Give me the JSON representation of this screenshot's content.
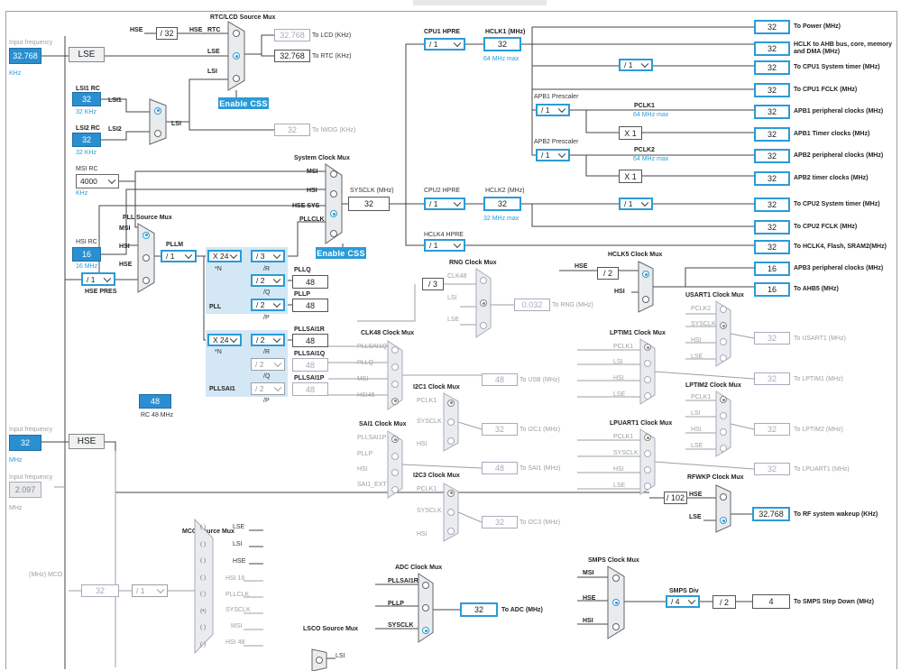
{
  "sections": {
    "rtc_mux": "RTC/LCD Source Mux",
    "system_mux": "System Clock Mux",
    "pll_mux": "PLL Source Mux",
    "hclk5_mux": "HCLK5 Clock Mux",
    "rng_mux": "RNG Clock Mux",
    "usart_mux": "USART1 Clock Mux",
    "clk48_mux": "CLK48 Clock Mux",
    "lptim1_mux": "LPTIM1 Clock Mux",
    "i2c1_mux": "I2C1 Clock Mux",
    "lptim2_mux": "LPTIM2 Clock Mux",
    "sai1_mux": "SAI1 Clock Mux",
    "lpuart_mux": "LPUART1 Clock Mux",
    "i2c3_mux": "I2C3 Clock Mux",
    "rfwkp_mux": "RFWKP Clock Mux",
    "mco_mux": "MCO Source Mux",
    "smps_mux": "SMPS Clock Mux",
    "adc_mux": "ADC Clock Mux",
    "lsco_mux": "LSCO Source Mux"
  },
  "inputs": {
    "lse_freq_label": "Input frequency",
    "lse_freq": "32.768",
    "lse_unit": "KHz",
    "lse_label": "LSE",
    "hse_freq_label": "Input frequency",
    "hse_freq": "32",
    "hse_unit": "MHz",
    "hse_label": "HSE",
    "third_freq_label": "Input frequency",
    "third_freq": "2.097",
    "third_unit": "MHz",
    "mco_label": "(MHz) MCO"
  },
  "rc": {
    "lsi1_label": "LSI1 RC",
    "lsi1_val": "32",
    "lsi1_unit": "32 KHz",
    "lsi2_label": "LSI2 RC",
    "lsi2_val": "32",
    "lsi2_unit": "32 KHz",
    "msi_label": "MSI RC",
    "msi_val": "4000",
    "msi_unit": "KHz",
    "hsi_label": "HSI RC",
    "hsi_val": "16",
    "hsi_unit": "16 MHz",
    "rc48_val": "48",
    "rc48_unit": "RC 48 MHz"
  },
  "labels": {
    "hse": "HSE",
    "rtc": "RTC",
    "div32": "/ 32",
    "lse": "LSE",
    "lsi": "LSI",
    "lsi1": "LSI1",
    "lsi2": "LSI2",
    "to_lcd": "To LCD (KHz)",
    "lcd_val": "32.768",
    "to_rtc": "To RTC (KHz)",
    "rtc_val": "32.768",
    "to_iwdg": "To IWDG (KHz)",
    "iwdg_val": "32",
    "enable_css": "Enable CSS",
    "msi": "MSI",
    "hsi": "HSI",
    "hse_sys": "HSE SYS",
    "pllclk": "PLLCLK",
    "sysclk_label": "SYSCLK (MHz)",
    "sysclk_val": "32",
    "hse_pres": "HSE PRES",
    "hse_pres_val": "/ 1",
    "pllm_label": "PLLM",
    "pllm_val": "/ 1",
    "pll": "PLL",
    "pllsai1": "PLLSAI1",
    "n_star": "*N",
    "r": "/R",
    "q": "/Q",
    "p": "/P",
    "x24": "X 24",
    "div3": "/ 3",
    "div2": "/ 2",
    "pllq": "PLLQ",
    "pllq_val": "48",
    "pllp": "PLLP",
    "pllp_val": "48",
    "pllsai1r": "PLLSAI1R",
    "pllsai1r_val": "48",
    "pllsai1q": "PLLSAI1Q",
    "pllsai1q_val": "48",
    "pllsai1p": "PLLSAI1P",
    "pllsai1p_val": "48",
    "cpu1_hpre": "CPU1 HPRE",
    "cpu1_val": "/ 1",
    "hclk1_label": "HCLK1 (MHz)",
    "hclk1_val": "32",
    "hclk1_max": "64 MHz max",
    "apb1_pres": "APB1 Prescaler",
    "apb1_val": "/ 1",
    "pclk1": "PCLK1",
    "pclk1_max": "64 MHz max",
    "apb2_pres": "APB2 Prescaler",
    "apb2_val": "/ 1",
    "pclk2": "PCLK2",
    "pclk2_max": "64 MHz max",
    "x1": "X 1",
    "cpu2_hpre": "CPU2 HPRE",
    "cpu2_val": "/ 1",
    "hclk2_label": "HCLK2 (MHz)",
    "hclk2_val": "32",
    "hclk2_max": "32 MHz max",
    "hclk4_hpre": "HCLK4 HPRE",
    "hclk4_val": "/ 1",
    "timer_div": "/ 1",
    "div2s": "/ 2",
    "rng_val": "0.032",
    "to_rng": "To RNG (MHz)",
    "to_usb": "To USB (MHz)",
    "usb_val": "48",
    "to_i2c1": "To I2C1 (MHz)",
    "i2c1_val": "32",
    "to_sai1": "To SAI1 (MHz)",
    "sai1_val": "48",
    "to_i2c3": "To I2C3 (MHz)",
    "i2c3_val": "32",
    "to_usart1": "To USART1 (MHz)",
    "usart1_val": "32",
    "to_lptim1": "To LPTIM1 (MHz)",
    "lptim1_val": "32",
    "to_lptim2": "To LPTIM2 (MHz)",
    "lptim2_val": "32",
    "to_lpuart1": "To LPUART1 (MHz)",
    "lpuart1_val": "32",
    "div102": "/ 102",
    "rf_val": "32.768",
    "to_rf": "To RF system wakeup (KHz)",
    "to_adc": "To ADC (MHz)",
    "adc_val": "32",
    "smps_div": "SMPS Div",
    "smps_div_val": "/ 4",
    "smps_val": "4",
    "to_smps": "To SMPS Step Down (MHz)",
    "mco_val": "32",
    "mco_div": "/ 1",
    "clk48": "CLK48",
    "div3b": "/ 3",
    "pclk1s": "PCLK1",
    "pclk2s": "PCLK2",
    "sysclk": "SYSCLK",
    "hsi48": "HSI48",
    "sai1_ext": "SAI1_EXT",
    "pllsai1r_s": "PLLSAI1R",
    "pllp_s": "PLLP",
    "pllq_s": "PLLQ",
    "hsi16": "HSI 16",
    "hsi48s": "HSI 48"
  },
  "outputs": [
    {
      "val": "32",
      "label": "To Power (MHz)"
    },
    {
      "val": "32",
      "label": "HCLK to AHB bus, core, memory and DMA (MHz)"
    },
    {
      "val": "32",
      "label": "To CPU1 System timer (MHz)"
    },
    {
      "val": "32",
      "label": "To CPU1 FCLK (MHz)"
    },
    {
      "val": "32",
      "label": "APB1 peripheral clocks (MHz)"
    },
    {
      "val": "32",
      "label": "APB1 Timer clocks (MHz)"
    },
    {
      "val": "32",
      "label": "APB2 peripheral clocks (MHz)"
    },
    {
      "val": "32",
      "label": "APB2 timer clocks (MHz)"
    },
    {
      "val": "32",
      "label": "To CPU2 System timer (MHz)"
    },
    {
      "val": "32",
      "label": "To CPU2 FCLK (MHz)"
    },
    {
      "val": "32",
      "label": "To HCLK4, Flash, SRAM2(MHz)"
    },
    {
      "val": "16",
      "label": "APB3 peripheral clocks (MHz)"
    },
    {
      "val": "16",
      "label": "To AHB5 (MHz)"
    }
  ],
  "colors": {
    "accent": "#2a9bd7",
    "fill": "#2a8fd1",
    "region": "#d4e7f5"
  }
}
